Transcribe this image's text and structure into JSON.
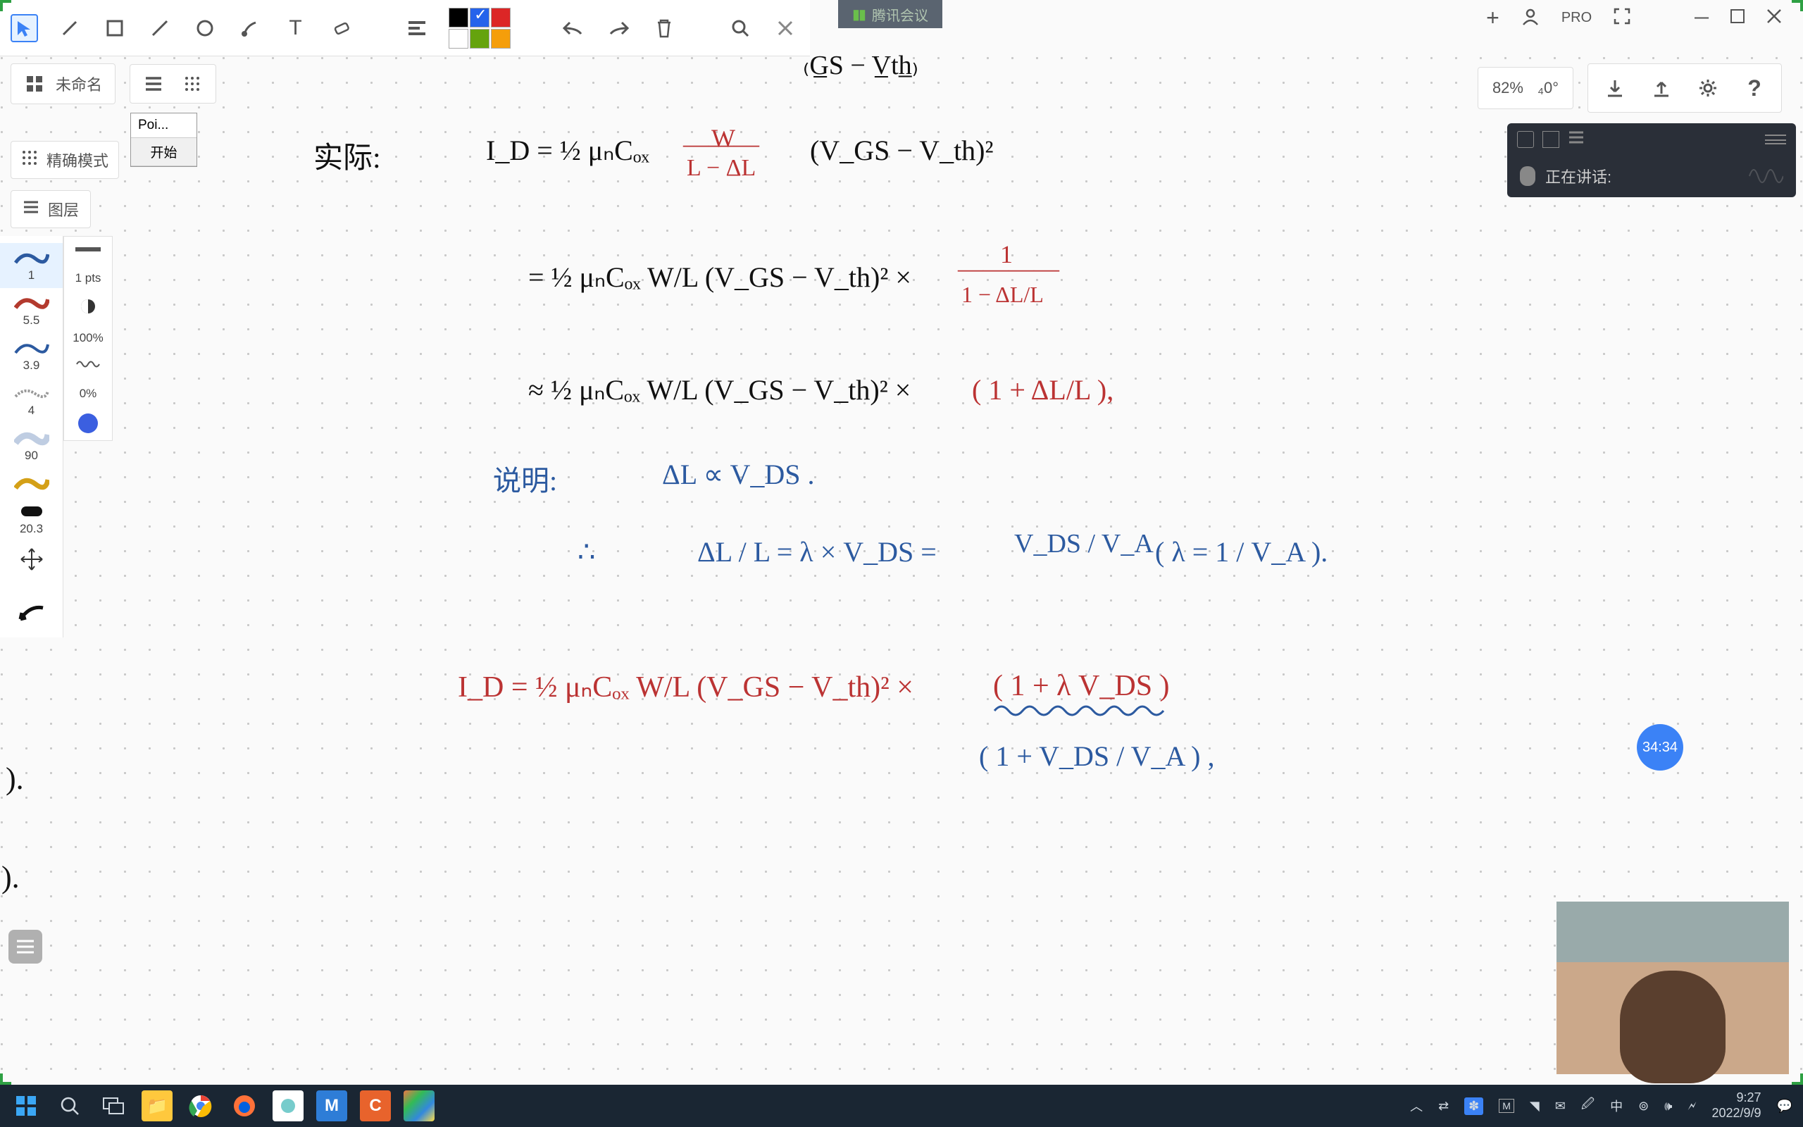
{
  "meeting_tab": "腾讯会议",
  "top": {
    "pro": "PRO"
  },
  "second_row": {
    "untitled": "未命名"
  },
  "popup": {
    "poi": "Poi...",
    "start": "开始"
  },
  "precise": "精确模式",
  "layers": "图层",
  "brush": {
    "b1": "1",
    "b2": "5.5",
    "b3": "3.9",
    "b4": "4",
    "b5": "90",
    "b7": "20.3",
    "pts": "1 pts",
    "p100": "100%",
    "p0": "0%"
  },
  "zoom": {
    "pct": "82%",
    "ang": "₄0°"
  },
  "tm": {
    "speaking": "正在讲话:"
  },
  "timer": "34:34",
  "clock": {
    "time": "9:27",
    "date": "2022/9/9"
  },
  "ime": "中",
  "notes": {
    "l0a": "₍G̲S − V̲th̲₎",
    "l1a": "实际:",
    "l1b": "I_D = ½ μₙCₒₓ",
    "l1c": "W",
    "l1d": "L − ΔL",
    "l1e": "(V_GS − V_th)²",
    "l2a": "= ½ μₙCₒₓ  W/L  (V_GS − V_th)²  ×",
    "l2b": "1",
    "l2c": "1 − ΔL/L",
    "l3a": "≈ ½ μₙCₒₓ  W/L  (V_GS − V_th)²  ×",
    "l3b": "( 1 + ΔL/L ),",
    "l4a": "说明:",
    "l4b": "ΔL ∝ V_DS .",
    "l5a": "∴",
    "l5b": "ΔL / L  =  λ × V_DS   =",
    "l5c": "V_DS / V_A",
    "l5d": "( λ = 1 / V_A ).",
    "l6a": "I_D  =  ½ μₙCₒₓ  W/L  (V_GS − V_th)²  ×",
    "l6b": "( 1 + λ V_DS )",
    "l6c": "( 1 + V_DS / V_A ) ,",
    "side1": ").",
    "side2": ")."
  }
}
